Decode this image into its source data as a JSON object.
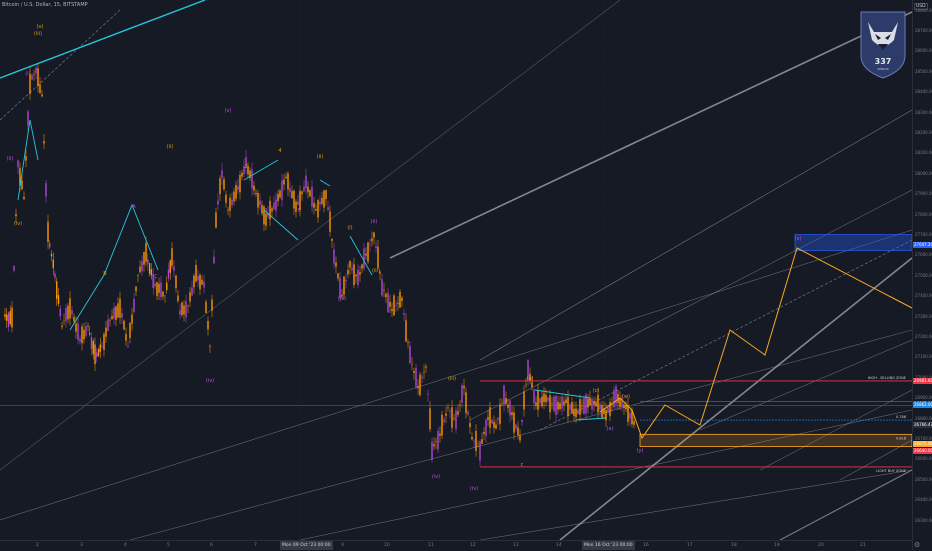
{
  "header": {
    "title": "Bitcoin / U.S. Dollar, 15, BITSTAMP",
    "currency": "USD"
  },
  "price_axis": {
    "ticks": [
      "28800.00",
      "28700.00",
      "28600.00",
      "28500.00",
      "28400.00",
      "28300.00",
      "28200.00",
      "28100.00",
      "28000.00",
      "27900.00",
      "27800.00",
      "27700.00",
      "27600.00",
      "27500.00",
      "27400.00",
      "27300.00",
      "27200.00",
      "27100.00",
      "27000.00",
      "26900.00",
      "26800.00",
      "26700.00",
      "26600.00",
      "26500.00",
      "26400.00",
      "26300.00"
    ],
    "tags": [
      {
        "label": "27647.20",
        "color": "#2962ff"
      },
      {
        "label": "26981.60",
        "color": "#f23645"
      },
      {
        "label": "26867.96",
        "color": "#363a45"
      },
      {
        "label": "26862.00",
        "color": "#1e88e5"
      },
      {
        "label": "26766.47",
        "color": "#2a2e39"
      },
      {
        "label": "26675.00",
        "color": "#ffa726"
      },
      {
        "label": "26640.00",
        "color": "#f23645"
      }
    ]
  },
  "time_axis": {
    "ticks": [
      "2",
      "3",
      "4",
      "5",
      "6",
      "7",
      "8",
      "9",
      "10",
      "11",
      "12",
      "13",
      "14",
      "15",
      "16",
      "17",
      "18",
      "19",
      "20",
      "21"
    ],
    "labels": [
      "Mon 09 Oct '23  00:00",
      "Mon 16 Oct '23  00:00"
    ]
  },
  "annotations": {
    "wave_labels": [
      "(i)",
      "(ii)",
      "(iii)",
      "(iv)",
      "(v)",
      "a",
      "b",
      "c",
      "(a)",
      "(b)",
      "(c)",
      "1",
      "2",
      "3",
      "4",
      "5",
      "A",
      "B",
      "C",
      "(w)",
      "(x)",
      "(y)"
    ],
    "level_labels": [
      "HIGH - SELLING ZONE",
      "0.786",
      "0.618",
      "LIGHT BUY ZONE"
    ]
  },
  "logo": {
    "label": "337",
    "sublabel": "SENIOR"
  },
  "colors": {
    "background": "#161a25",
    "candle": "#ff9800",
    "candle_alt": "#b048d8",
    "wave_label": "#d4a017",
    "wave_label_alt": "#c04de0",
    "trend": "#26c6da",
    "forecast": "#f6a823",
    "channel": "#b2b5be",
    "sell_zone": "#f23645",
    "buy_zone": "#ffa726",
    "target_zone": "#2962ff"
  }
}
